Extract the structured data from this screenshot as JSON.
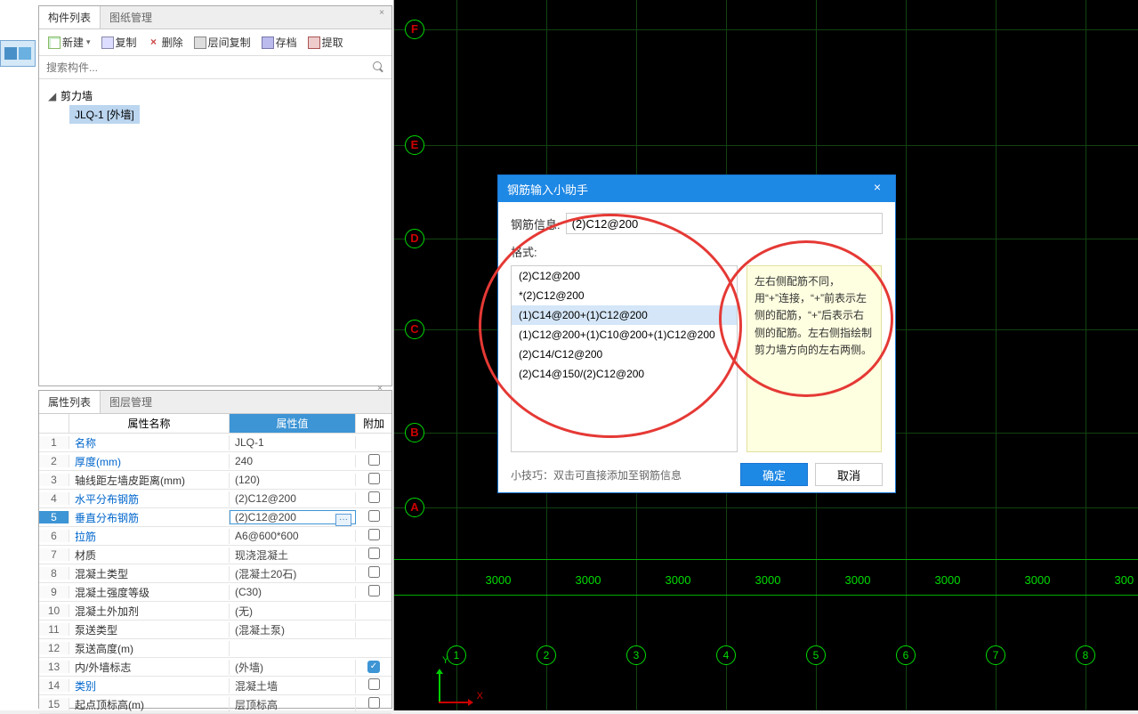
{
  "left": {
    "tabs": {
      "components": "构件列表",
      "drawings": "图纸管理"
    },
    "toolbar": {
      "new": "新建",
      "copy": "复制",
      "delete": "删除",
      "floorcopy": "层间复制",
      "save": "存档",
      "extract": "提取"
    },
    "search_placeholder": "搜索构件...",
    "tree": {
      "root": "剪力墙",
      "child": "JLQ-1 [外墙]"
    }
  },
  "bottom": {
    "tabs": {
      "props": "属性列表",
      "layers": "图层管理"
    },
    "heads": {
      "name": "属性名称",
      "value": "属性值",
      "add": "附加"
    },
    "rows": [
      {
        "n": "1",
        "name": "名称",
        "val": "JLQ-1",
        "blue": true
      },
      {
        "n": "2",
        "name": "厚度(mm)",
        "val": "240",
        "blue": true,
        "cb": true
      },
      {
        "n": "3",
        "name": "轴线距左墙皮距离(mm)",
        "val": "(120)",
        "blue": false,
        "cb": true
      },
      {
        "n": "4",
        "name": "水平分布钢筋",
        "val": "(2)C12@200",
        "blue": true,
        "cb": true
      },
      {
        "n": "5",
        "name": "垂直分布钢筋",
        "val": "(2)C12@200",
        "blue": true,
        "cb": true,
        "sel": true,
        "edit": true
      },
      {
        "n": "6",
        "name": "拉筋",
        "val": "A6@600*600",
        "blue": true,
        "cb": true
      },
      {
        "n": "7",
        "name": "材质",
        "val": "现浇混凝土",
        "blue": false,
        "cb": true
      },
      {
        "n": "8",
        "name": "混凝土类型",
        "val": "(混凝土20石)",
        "blue": false,
        "cb": true
      },
      {
        "n": "9",
        "name": "混凝土强度等级",
        "val": "(C30)",
        "blue": false,
        "cb": true
      },
      {
        "n": "10",
        "name": "混凝土外加剂",
        "val": "(无)",
        "blue": false
      },
      {
        "n": "11",
        "name": "泵送类型",
        "val": "(混凝土泵)",
        "blue": false
      },
      {
        "n": "12",
        "name": "泵送高度(m)",
        "val": "",
        "blue": false
      },
      {
        "n": "13",
        "name": "内/外墙标志",
        "val": "(外墙)",
        "blue": false,
        "checked": true
      },
      {
        "n": "14",
        "name": "类别",
        "val": "混凝土墙",
        "blue": true,
        "cb": true
      },
      {
        "n": "15",
        "name": "起点顶标高(m)",
        "val": "层顶标高",
        "blue": false,
        "cb": true
      }
    ]
  },
  "canvas": {
    "hlabels": [
      "F",
      "E",
      "D",
      "C",
      "B",
      "A"
    ],
    "vlabels": [
      "1",
      "2",
      "3",
      "4",
      "5",
      "6",
      "7",
      "8"
    ],
    "dim": "3000",
    "coord": {
      "x": "X",
      "y": "Y"
    }
  },
  "dialog": {
    "title": "钢筋输入小助手",
    "info_label": "钢筋信息:",
    "info_value": "(2)C12@200",
    "format_label": "格式:",
    "options": [
      "(2)C12@200",
      "*(2)C12@200",
      "(1)C14@200+(1)C12@200",
      "(1)C12@200+(1)C10@200+(1)C12@200",
      "(2)C14/C12@200",
      "(2)C14@150/(2)C12@200"
    ],
    "selected": 2,
    "desc": "左右侧配筋不同，用“+”连接，“+”前表示左侧的配筋，“+”后表示右侧的配筋。左右侧指绘制剪力墙方向的左右两侧。",
    "tip": "小技巧：双击可直接添加至钢筋信息",
    "ok": "确定",
    "cancel": "取消"
  }
}
